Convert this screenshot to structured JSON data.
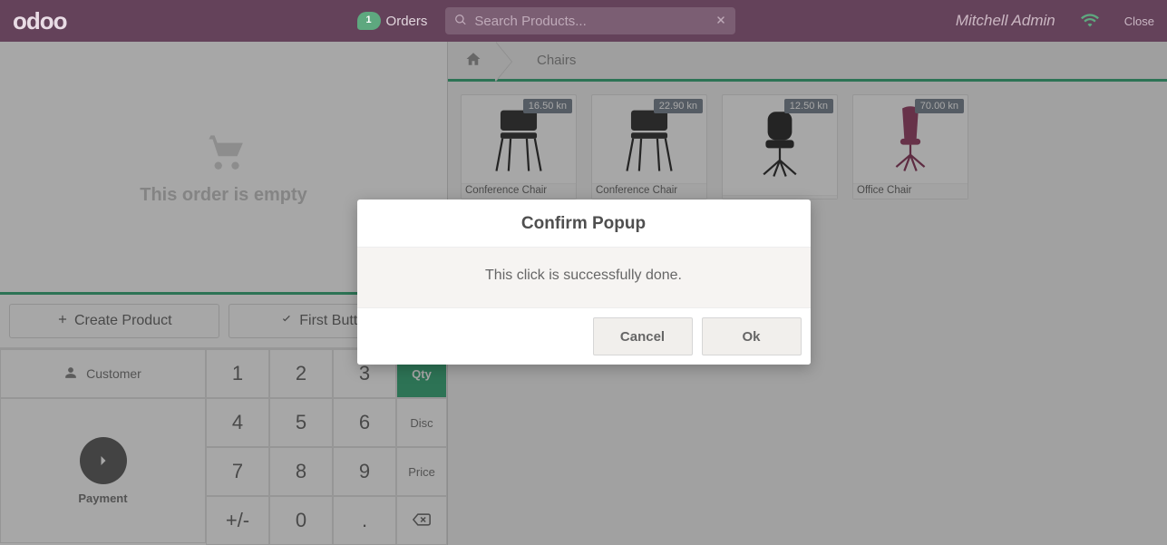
{
  "header": {
    "brand": "odoo",
    "orders_label": "Orders",
    "orders_count": "1",
    "search_placeholder": "Search Products...",
    "user_name": "Mitchell Admin",
    "close_label": "Close"
  },
  "order_panel": {
    "empty_text": "This order is empty"
  },
  "actions": {
    "create_product": "Create Product",
    "first_button": "First Button F"
  },
  "customer_label": "Customer",
  "payment_label": "Payment",
  "numpad": {
    "keys": [
      "1",
      "2",
      "3",
      "4",
      "5",
      "6",
      "7",
      "8",
      "9",
      "+/-",
      "0",
      "."
    ],
    "modes": {
      "qty": "Qty",
      "disc": "Disc",
      "price": "Price"
    }
  },
  "breadcrumb": {
    "category": "Chairs"
  },
  "products": [
    {
      "name": "Conference Chair",
      "price": "16.50 kn",
      "variant": "simple-black"
    },
    {
      "name": "Conference Chair",
      "price": "22.90 kn",
      "variant": "simple-black"
    },
    {
      "name": "",
      "price": "12.50 kn",
      "variant": "office-black"
    },
    {
      "name": "Office Chair",
      "price": "70.00 kn",
      "variant": "office-magenta"
    }
  ],
  "dialog": {
    "title": "Confirm Popup",
    "message": "This click is successfully done.",
    "cancel": "Cancel",
    "ok": "Ok"
  }
}
